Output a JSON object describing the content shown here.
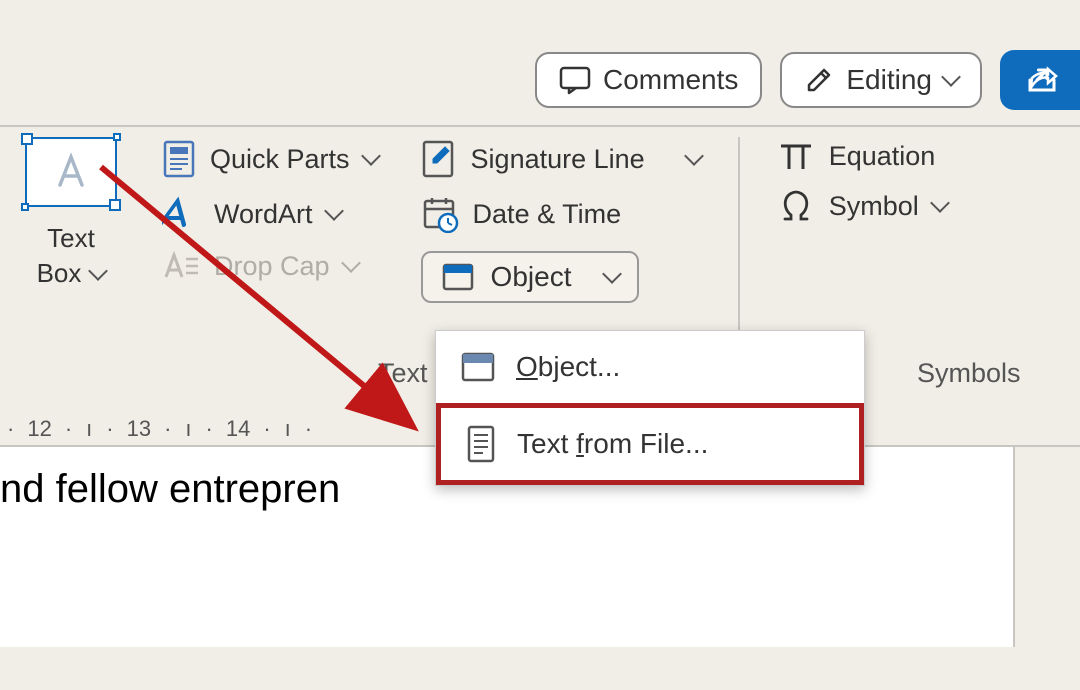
{
  "topButtons": {
    "comments": "Comments",
    "editing": "Editing"
  },
  "ribbon": {
    "textBox": {
      "line1": "Text",
      "line2": "Box"
    },
    "quickParts": "Quick Parts",
    "wordArt": "WordArt",
    "dropCap": "Drop Cap",
    "signatureLine": "Signature Line",
    "dateTime": "Date & Time",
    "object": "Object",
    "equation": "Equation",
    "symbol": "Symbol"
  },
  "groupLabels": {
    "text": "Text",
    "symbols": "Symbols"
  },
  "ruler": {
    "marks": [
      "12",
      "13",
      "14"
    ]
  },
  "document": {
    "visibleText": "nd fellow entrepren"
  },
  "dropdown": {
    "objectItem": "bject...",
    "objectPrefix": "O",
    "textFromFilePrefix": "Text ",
    "textFromFileUnder": "f",
    "textFromFileSuffix": "rom File..."
  }
}
